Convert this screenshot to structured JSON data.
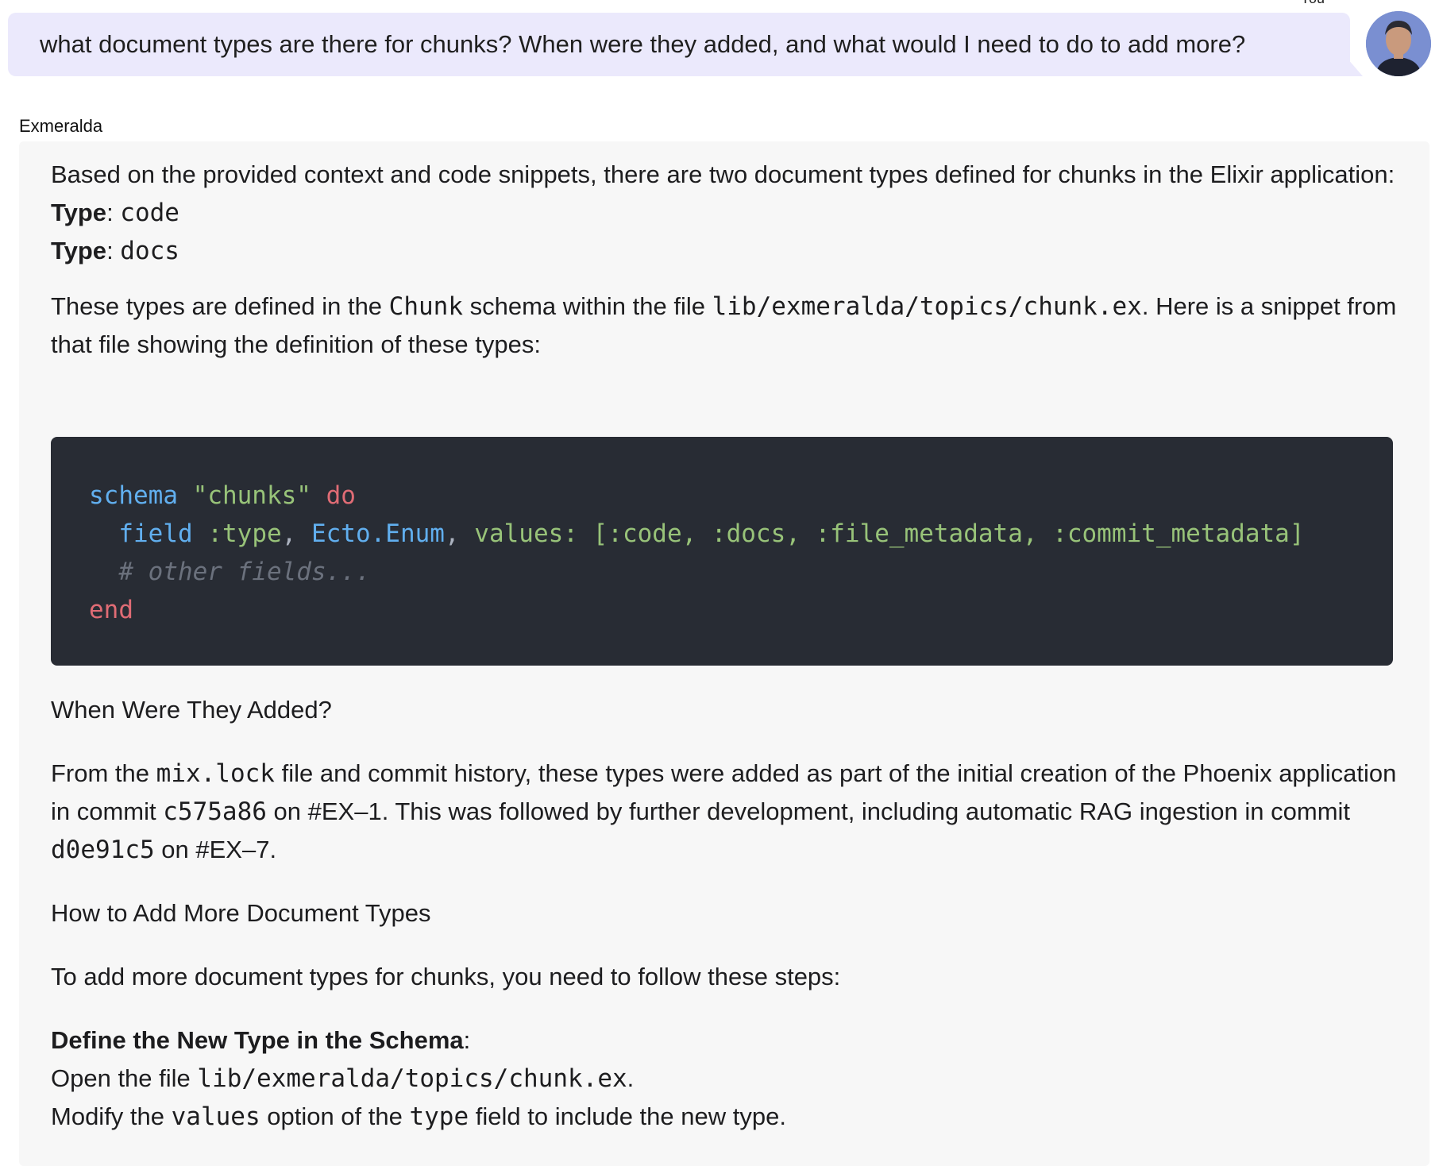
{
  "user": {
    "label": "You",
    "message": "what document types are there for chunks? When were they added, and what would I need to do to add more?"
  },
  "assistant": {
    "name": "Exmeralda",
    "intro": "Based on the provided context and code snippets, there are two document types defined for chunks in the Elixir application:",
    "types": [
      {
        "label": "Type",
        "value": "code"
      },
      {
        "label": "Type",
        "value": "docs"
      }
    ],
    "defined_prefix": "These types are defined in the ",
    "defined_schema": "Chunk",
    "defined_mid": " schema within the file ",
    "defined_file": "lib/exmeralda/topics/chunk.ex",
    "defined_suffix": ". Here is a snippet from that file showing the definition of these types:",
    "code": {
      "line1_kw": "schema",
      "line1_str": "\"chunks\"",
      "line1_do": "do",
      "line2_field": "field",
      "line2_type": ":type",
      "line2_enum": "Ecto.Enum",
      "line2_values": "values:",
      "line2_list": "[:code, :docs, :file_metadata, :commit_metadata]",
      "line3_comment": "# other fields...",
      "line4_end": "end"
    },
    "heading_when": "When Were They Added?",
    "when_p1_a": "From the ",
    "when_p1_mixlock": "mix.lock",
    "when_p1_b": " file and commit history, these types were added as part of the initial creation of the Phoenix application in commit ",
    "when_commit1": "c575a86",
    "when_p1_c": " on #EX–1. This was followed by further development, including automatic RAG ingestion in commit ",
    "when_commit2": "d0e91c5",
    "when_p1_d": " on #EX–7.",
    "heading_how": "How to Add More Document Types",
    "how_intro": "To add more document types for chunks, you need to follow these steps:",
    "step1_title": "Define the New Type in the Schema",
    "step1_line1_a": "Open the file ",
    "step1_line1_file": "lib/exmeralda/topics/chunk.ex",
    "step1_line1_b": ".",
    "step1_line2_a": "Modify the ",
    "step1_line2_values": "values",
    "step1_line2_b": " option of the ",
    "step1_line2_type": "type",
    "step1_line2_c": " field to include the new type."
  }
}
